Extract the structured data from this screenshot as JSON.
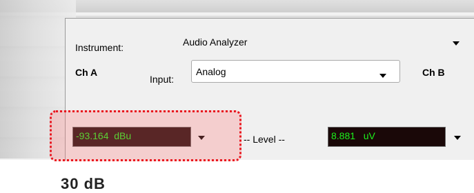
{
  "instrument": {
    "label": "Instrument:",
    "value": "Audio Analyzer"
  },
  "channel_a": {
    "label": "Ch A"
  },
  "channel_b": {
    "label": "Ch B"
  },
  "input": {
    "label": "Input:",
    "value": "Analog"
  },
  "level": {
    "label": "-- Level --",
    "ch_a_reading": "-93.164  dBu",
    "ch_b_reading": "8.881   uV"
  },
  "background": {
    "partial_text": "30 dB"
  },
  "colors": {
    "meter_text": "#1cf21c",
    "meter_bg": "#1a0808",
    "highlight_border": "#e8141d"
  },
  "icons": [
    "chevron-down-icon"
  ]
}
